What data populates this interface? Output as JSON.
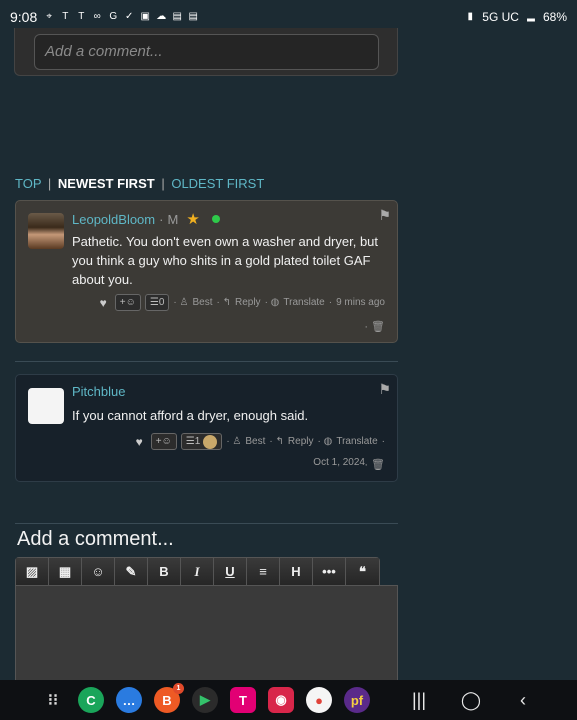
{
  "statusbar": {
    "time": "9:08",
    "left_icons": [
      "location-icon",
      "tmobile-icon",
      "tmobile-icon",
      "voicemail-icon",
      "google-icon",
      "check-icon",
      "gallery-icon",
      "cloud-icon",
      "card-icon",
      "card-icon"
    ],
    "network": "5G UC",
    "battery": "68%"
  },
  "top_comment": {
    "placeholder": "Add a comment..."
  },
  "sort": {
    "top": "TOP",
    "newest": "NEWEST FIRST",
    "oldest": "OLDEST FIRST",
    "separator": "|"
  },
  "comments": [
    {
      "author": "LeopoldBloom",
      "dot": "·",
      "badge": "M",
      "text": "Pathetic. You don't even own a washer and dryer, but you think a guy who shits in a gold plated toilet GAF about you.",
      "reaction_label": "+☺",
      "list_count": "0",
      "best": "Best",
      "reply": "Reply",
      "translate": "Translate",
      "time": "9 mins ago"
    },
    {
      "author": "Pitchblue",
      "text": "If you cannot afford a dryer, enough said.",
      "reaction_label": "+☺",
      "list_count": "1",
      "best": "Best",
      "reply": "Reply",
      "translate": "Translate",
      "date": "Oct 1, 2024"
    }
  ],
  "add_comment": {
    "title": "Add a comment...",
    "toolbar": [
      "image-icon",
      "video-icon",
      "emoji-icon",
      "brush-icon",
      "B",
      "I",
      "U",
      "strikethrough-icon",
      "H",
      "more-icon",
      "quote-icon"
    ]
  },
  "navbar": {
    "apps": [
      "grid-icon",
      "phone-icon",
      "messages-icon",
      "brave-icon",
      "play-store-icon",
      "tmobile-icon",
      "screen-recorder-icon",
      "maps-icon",
      "pf-icon"
    ],
    "brave_badge": "1"
  },
  "colors": {
    "link": "#5fb7c6",
    "background": "#1c2b33"
  }
}
